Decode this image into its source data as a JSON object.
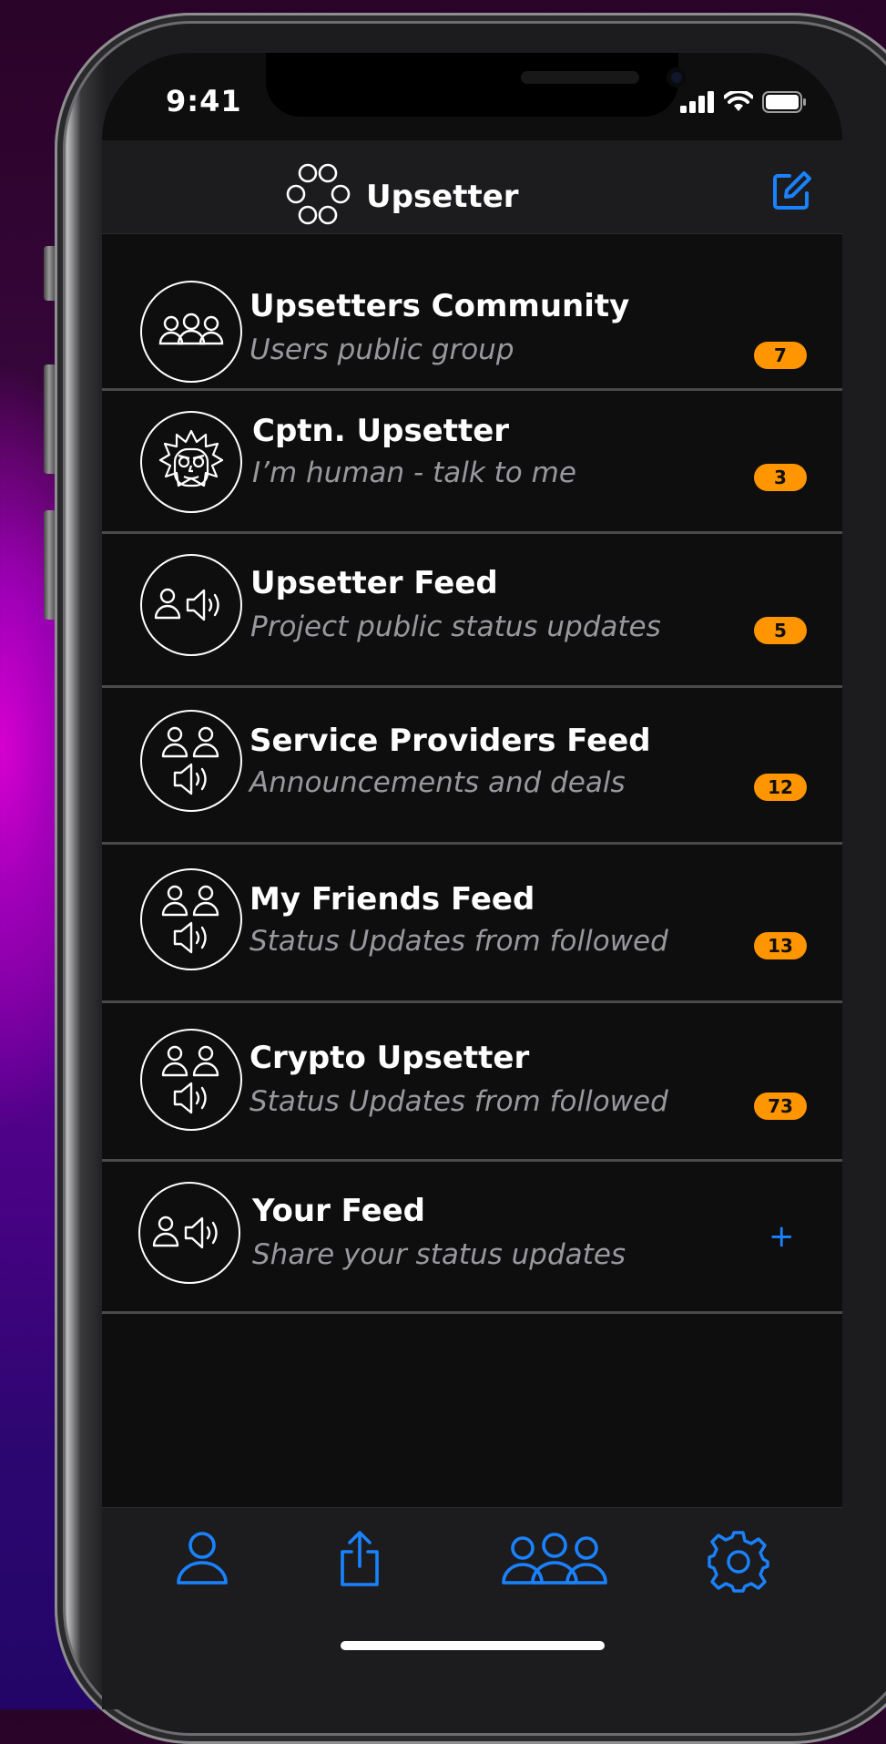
{
  "status_bar": {
    "time": "9:41",
    "icons": [
      "cellular-signal-icon",
      "wifi-icon",
      "battery-icon"
    ]
  },
  "header": {
    "app_name": "Upsetter",
    "logo_icon": "circles-logo-icon",
    "compose_icon": "compose-icon"
  },
  "conversations": [
    {
      "title": "Upsetters Community",
      "subtitle": "Users public group",
      "badge": "7",
      "icon": "group-icon"
    },
    {
      "title": "Cptn. Upsetter",
      "subtitle": "I’m human - talk to me",
      "badge": "3",
      "icon": "robot-face-icon"
    },
    {
      "title": "Upsetter Feed",
      "subtitle": "Project public status updates",
      "badge": "5",
      "icon": "user-speaker-icon"
    },
    {
      "title": "Service Providers Feed",
      "subtitle": "Announcements and deals",
      "badge": "12",
      "icon": "users-speaker-icon"
    },
    {
      "title": "My Friends Feed",
      "subtitle": "Status Updates from followed",
      "badge": "13",
      "icon": "users-speaker-icon"
    },
    {
      "title": "Crypto Upsetter",
      "subtitle": "Status Updates from followed",
      "badge": "73",
      "icon": "users-speaker-icon"
    },
    {
      "title": "Your Feed",
      "subtitle": "Share your status updates",
      "action": "+",
      "icon": "user-speaker-icon"
    }
  ],
  "tab_bar": {
    "tabs": [
      "profile-icon",
      "share-icon",
      "groups-icon",
      "settings-icon"
    ],
    "active_color": "#1a82ff"
  },
  "colors": {
    "badge": "#ff9500",
    "accent": "#1a82ff",
    "background": "#0e0e0f"
  }
}
